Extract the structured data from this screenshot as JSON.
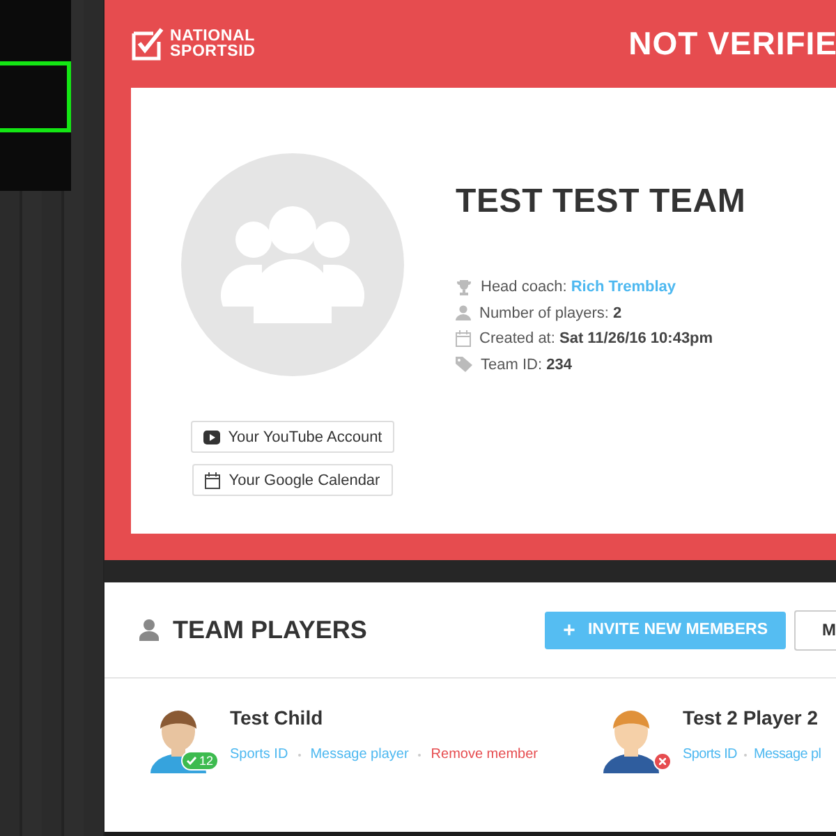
{
  "brand": {
    "logo_line_1": "NATIONAL",
    "logo_line_2": "SPORTSID"
  },
  "status_banner": "NOT VERIFIE",
  "team": {
    "name": "TEST TEST TEAM",
    "details": [
      {
        "kind": "coach",
        "label": "Head coach:",
        "value": "Rich Tremblay"
      },
      {
        "kind": "players",
        "label": "Number of players:",
        "value": "2"
      },
      {
        "kind": "created",
        "label": "Created at:",
        "value": "Sat 11/26/16 10:43pm"
      },
      {
        "kind": "id",
        "label": "Team ID:",
        "value": "234"
      }
    ],
    "buttons": [
      {
        "kind": "youtube",
        "label": "Your YouTube Account"
      },
      {
        "kind": "calendar",
        "label": "Your Google Calendar"
      }
    ]
  },
  "players_panel": {
    "title": "TEAM PLAYERS",
    "buttons": [
      {
        "kind": "primary",
        "icon": "+",
        "label": "INVITE NEW MEMBERS"
      },
      {
        "kind": "flag",
        "label": "M"
      }
    ],
    "players": [
      {
        "name": "Test Child",
        "verified": true,
        "badge": "12",
        "links": [
          {
            "label": "Sports ID",
            "kind": "normal"
          },
          {
            "label": "Message player",
            "kind": "normal"
          },
          {
            "label": "Remove member",
            "kind": "danger"
          }
        ]
      },
      {
        "name": "Test 2 Player 2",
        "verified": false,
        "links": [
          {
            "label": "Sports ID",
            "kind": "normal"
          },
          {
            "label": "Message pl",
            "kind": "normal"
          }
        ]
      }
    ]
  }
}
